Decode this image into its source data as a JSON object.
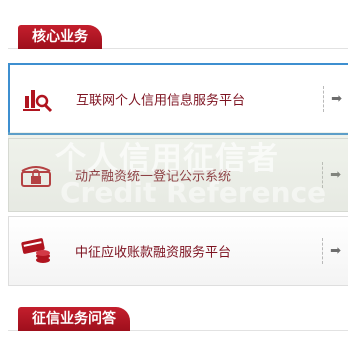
{
  "sections": {
    "core_business": {
      "title": "核心业务"
    },
    "credit_qa": {
      "title": "征信业务问答"
    }
  },
  "services": [
    {
      "label": "互联网个人信用信息服务平台",
      "icon": "magnifier-bars-icon"
    },
    {
      "label": "动产融资统一登记公示系统",
      "icon": "lock-icon"
    },
    {
      "label": "中征应收账款融资服务平台",
      "icon": "card-coins-icon"
    }
  ],
  "arrow_glyph": "➡",
  "watermark": {
    "line1": "个人信用征信者",
    "line2": "Credit Reference"
  },
  "colors": {
    "brand_red": "#b0141f",
    "label_red": "#7d1220",
    "active_border": "#3d8fd0"
  }
}
